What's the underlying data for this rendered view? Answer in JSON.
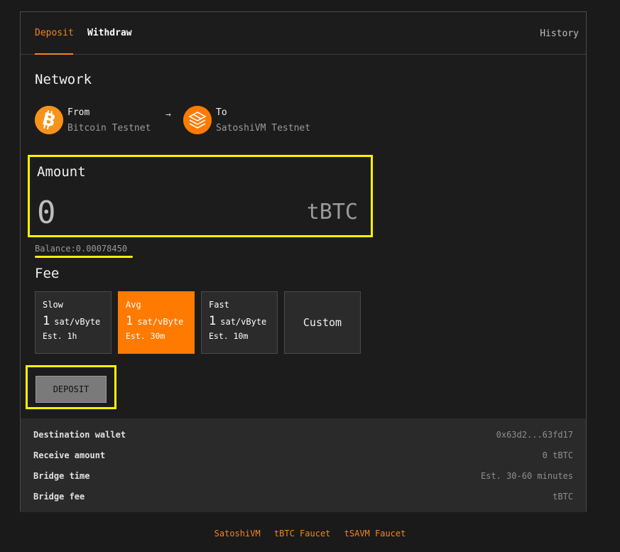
{
  "tabs": {
    "deposit": "Deposit",
    "withdraw": "Withdraw",
    "history": "History"
  },
  "network": {
    "heading": "Network",
    "from_label": "From",
    "from_name": "Bitcoin Testnet",
    "from_icon": "bitcoin-icon",
    "arrow": "→",
    "to_label": "To",
    "to_name": "SatoshiVM Testnet",
    "to_icon": "satoshivm-icon"
  },
  "amount": {
    "heading": "Amount",
    "value": "0",
    "unit": "tBTC"
  },
  "balance": "Balance:0.00078450",
  "fee": {
    "heading": "Fee",
    "options": [
      {
        "name": "Slow",
        "rate": "1",
        "unit": "sat/vByte",
        "est": "Est. 1h"
      },
      {
        "name": "Avg",
        "rate": "1",
        "unit": "sat/vByte",
        "est": "Est. 30m"
      },
      {
        "name": "Fast",
        "rate": "1",
        "unit": "sat/vByte",
        "est": "Est. 10m"
      }
    ],
    "custom_label": "Custom",
    "selected": "Avg"
  },
  "deposit_button": "DEPOSIT",
  "summary": [
    {
      "label": "Destination wallet",
      "value": "0x63d2...63fd17"
    },
    {
      "label": "Receive amount",
      "value": "0 tBTC"
    },
    {
      "label": "Bridge time",
      "value": "Est. 30-60 minutes"
    },
    {
      "label": "Bridge fee",
      "value": "tBTC"
    }
  ],
  "footer_links": [
    "SatoshiVM",
    "tBTC Faucet",
    "tSAVM Faucet"
  ],
  "colors": {
    "accent": "#f5841f",
    "selected_fee": "#ff7a00",
    "highlight": "#fff200",
    "background": "#1a1a1a"
  }
}
